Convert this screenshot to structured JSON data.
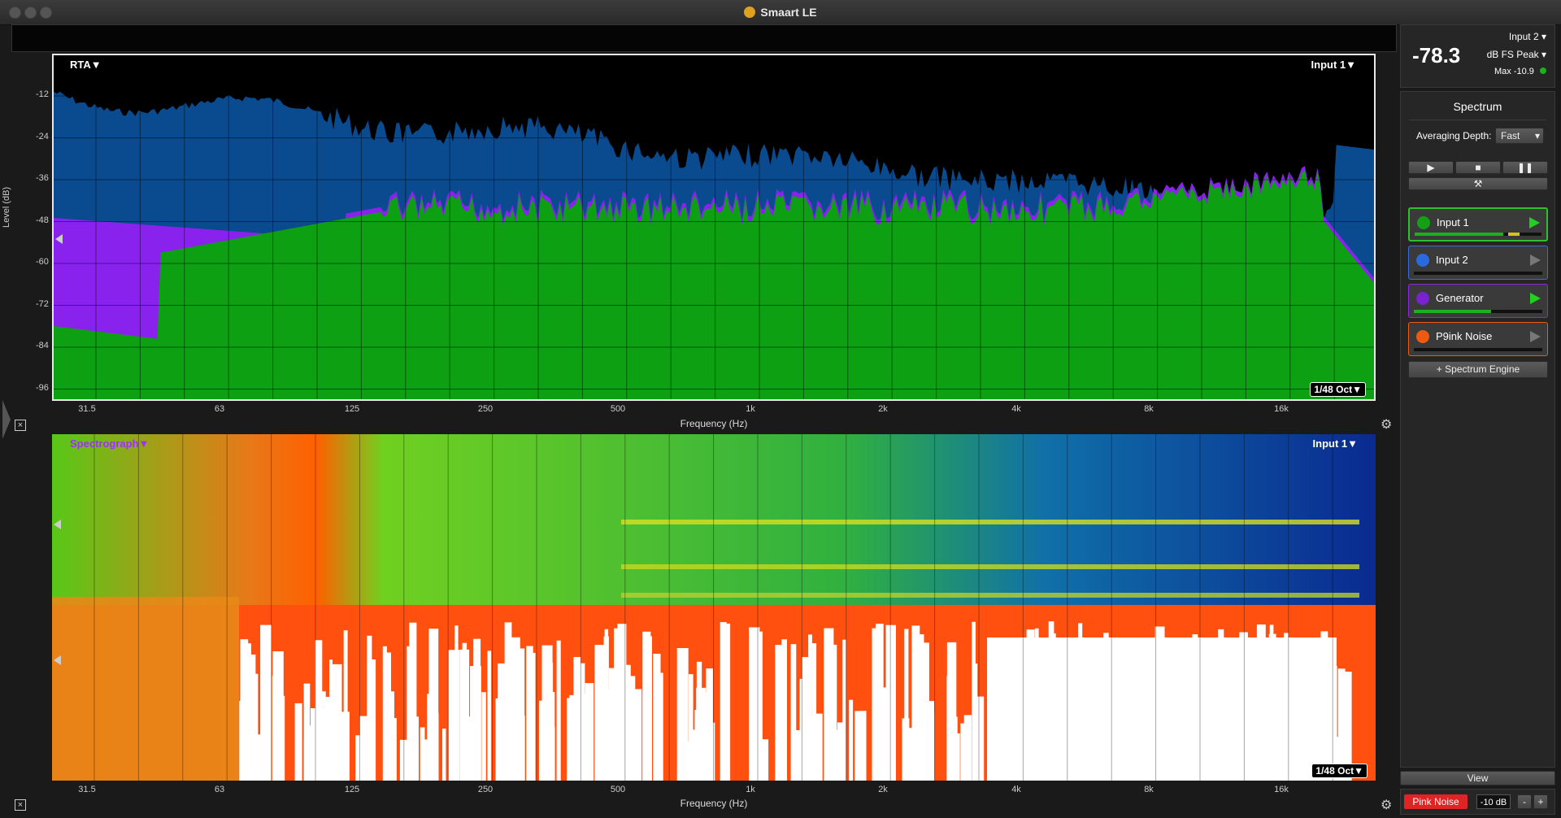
{
  "window": {
    "title": "Smaart LE"
  },
  "colors": {
    "rta_blue": "#0a4a8e",
    "rta_purple": "#8a22ee",
    "rta_green": "#0ca012",
    "input1": "#14a014",
    "input2": "#2a6adf",
    "generator": "#7a22cc",
    "pink_noise": "#ee5a10",
    "pink_button": "#e02424"
  },
  "rta": {
    "mode_label": "RTA▼",
    "input_label": "Input 1▼",
    "resolution_label": "1/48 Oct▼",
    "y_axis_title": "Level (dB)",
    "y_ticks": [
      "-12",
      "-24",
      "-36",
      "-48",
      "-60",
      "-72",
      "-84",
      "-96"
    ],
    "x_axis_title": "Frequency (Hz)",
    "x_ticks": [
      "31.5",
      "63",
      "125",
      "250",
      "500",
      "1k",
      "2k",
      "4k",
      "8k",
      "16k"
    ]
  },
  "spectrograph": {
    "mode_label": "Spectrograph▼",
    "input_label": "Input 1▼",
    "resolution_label": "1/48 Oct▼",
    "x_axis_title": "Frequency (Hz)",
    "x_ticks": [
      "31.5",
      "63",
      "125",
      "250",
      "500",
      "1k",
      "2k",
      "4k",
      "8k",
      "16k"
    ]
  },
  "meter": {
    "value": "-78.3",
    "input": "Input 2",
    "mode": "dB FS Peak",
    "max": "Max -10.9"
  },
  "spectrum_panel": {
    "title": "Spectrum",
    "avg_label": "Averaging Depth:",
    "avg_value": "Fast",
    "channels": [
      {
        "name": "Input 1",
        "color": "#14a014",
        "active": true
      },
      {
        "name": "Input 2",
        "color": "#2a6adf",
        "active": false
      },
      {
        "name": "Generator",
        "color": "#7a22cc",
        "active": true
      },
      {
        "name": "P9ink Noise",
        "color": "#ee5a10",
        "active": false
      }
    ],
    "add_engine": "+ Spectrum Engine"
  },
  "view_button": "View",
  "generator": {
    "label": "Pink Noise",
    "level": "-10 dB",
    "minus": "-",
    "plus": "+"
  }
}
